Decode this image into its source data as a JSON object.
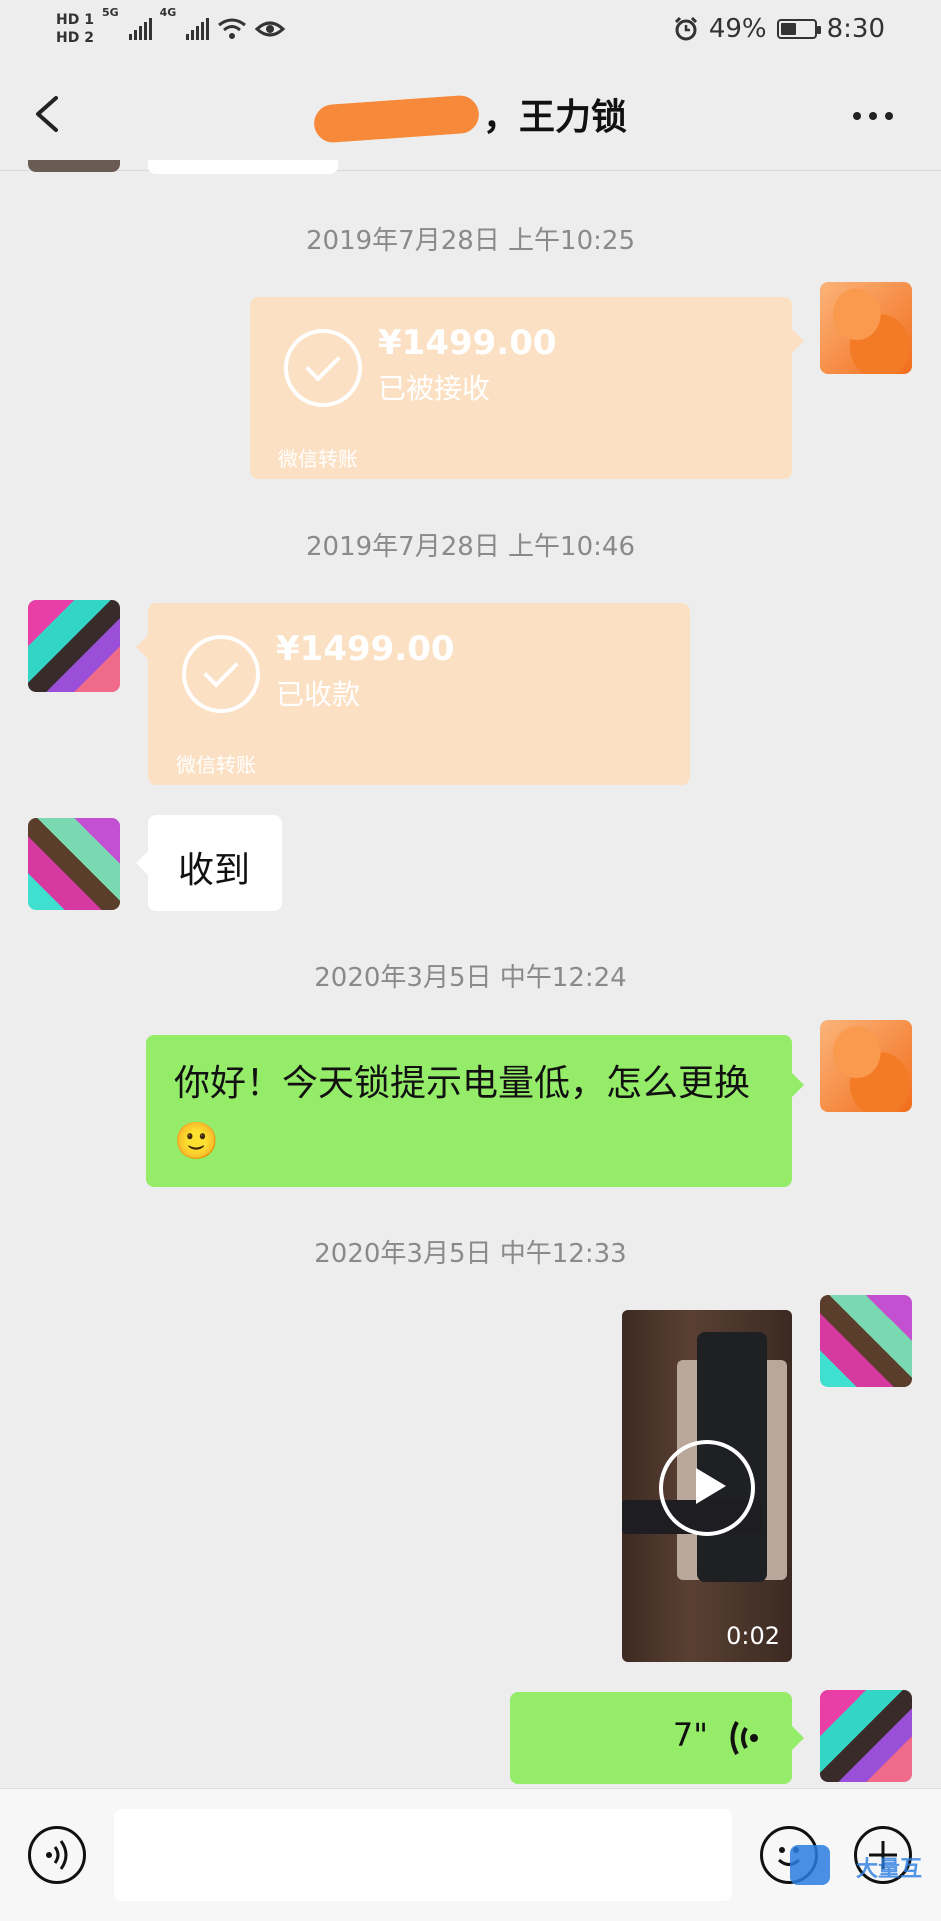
{
  "status_bar": {
    "hd1": "HD 1",
    "hd2": "HD 2",
    "net1": "5G",
    "net2": "4G",
    "battery": "49%",
    "battery_level": 0.49,
    "time": "8:30"
  },
  "nav": {
    "title": "，王力锁"
  },
  "messages": {
    "ts1": "2019年7月28日 上午10:25",
    "transfer_sent": {
      "amount": "¥1499.00",
      "status": "已被接收",
      "footer": "微信转账"
    },
    "ts2": "2019年7月28日 上午10:46",
    "transfer_received": {
      "amount": "¥1499.00",
      "status": "已收款",
      "footer": "微信转账"
    },
    "reply_text": "收到",
    "ts3": "2020年3月5日 中午12:24",
    "question_text": "你好！今天锁提示电量低，怎么更换",
    "question_emoji": "🙂",
    "ts4": "2020年3月5日 中午12:33",
    "video_duration": "0:02",
    "voice_duration": "7\""
  },
  "input_bar": {
    "input_value": ""
  },
  "watermark": {
    "text": "大量互"
  },
  "colors": {
    "background": "#ededed",
    "green_bubble": "#95ec69",
    "transfer_card": "#fbe0c4",
    "redaction_orange": "#f7893a"
  }
}
